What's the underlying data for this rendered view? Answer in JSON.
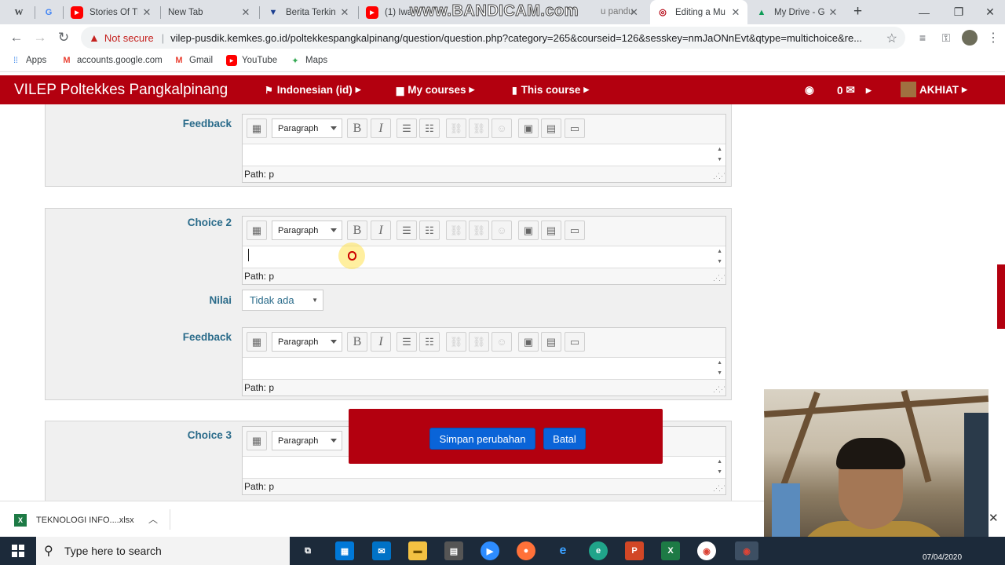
{
  "browser": {
    "tabs": [
      {
        "icon": "W",
        "title": ""
      },
      {
        "icon": "G",
        "title": ""
      },
      {
        "icon": "▶",
        "title": "Stories Of Th"
      },
      {
        "icon": "",
        "title": "New Tab"
      },
      {
        "icon": "▼",
        "title": "Berita Terkini"
      },
      {
        "icon": "▶",
        "title": "(1) Iwa"
      },
      {
        "icon": "◎",
        "title": "Editing a Mu"
      },
      {
        "icon": "▲",
        "title": "My Drive - G"
      }
    ],
    "watermark": "www.BANDICAM.com",
    "watermark_tail": "u pandu",
    "new_tab": "+",
    "window_buttons": [
      "—",
      "❐",
      "✕"
    ],
    "security_label": "Not secure",
    "url": "vilep-pusdik.kemkes.go.id/poltekkespangkalpinang/question/question.php?category=265&courseid=126&sesskey=nmJaONnEvt&qtype=multichoice&re...",
    "bookmarks": [
      "Apps",
      "accounts.google.com",
      "Gmail",
      "YouTube",
      "Maps"
    ]
  },
  "moodle": {
    "brand": "VILEP Poltekkes Pangkalpinang",
    "nav": {
      "language": "Indonesian (id)",
      "my_courses": "My courses",
      "this_course": "This course",
      "messages_count": "0",
      "user": "AKHIAT"
    }
  },
  "form": {
    "feedback_label": "Feedback",
    "choice2_label": "Choice 2",
    "nilai_label": "Nilai",
    "nilai_value": "Tidak ada",
    "choice3_label": "Choice 3",
    "paragraph_option": "Paragraph",
    "path_text": "Path: p",
    "save_button": "Simpan perubahan",
    "cancel_button": "Batal"
  },
  "downloads": {
    "file_name": "TEKNOLOGI INFO....xlsx",
    "file_badge": "X"
  },
  "taskbar": {
    "search_placeholder": "Type here to search",
    "date": "07/04/2020"
  }
}
